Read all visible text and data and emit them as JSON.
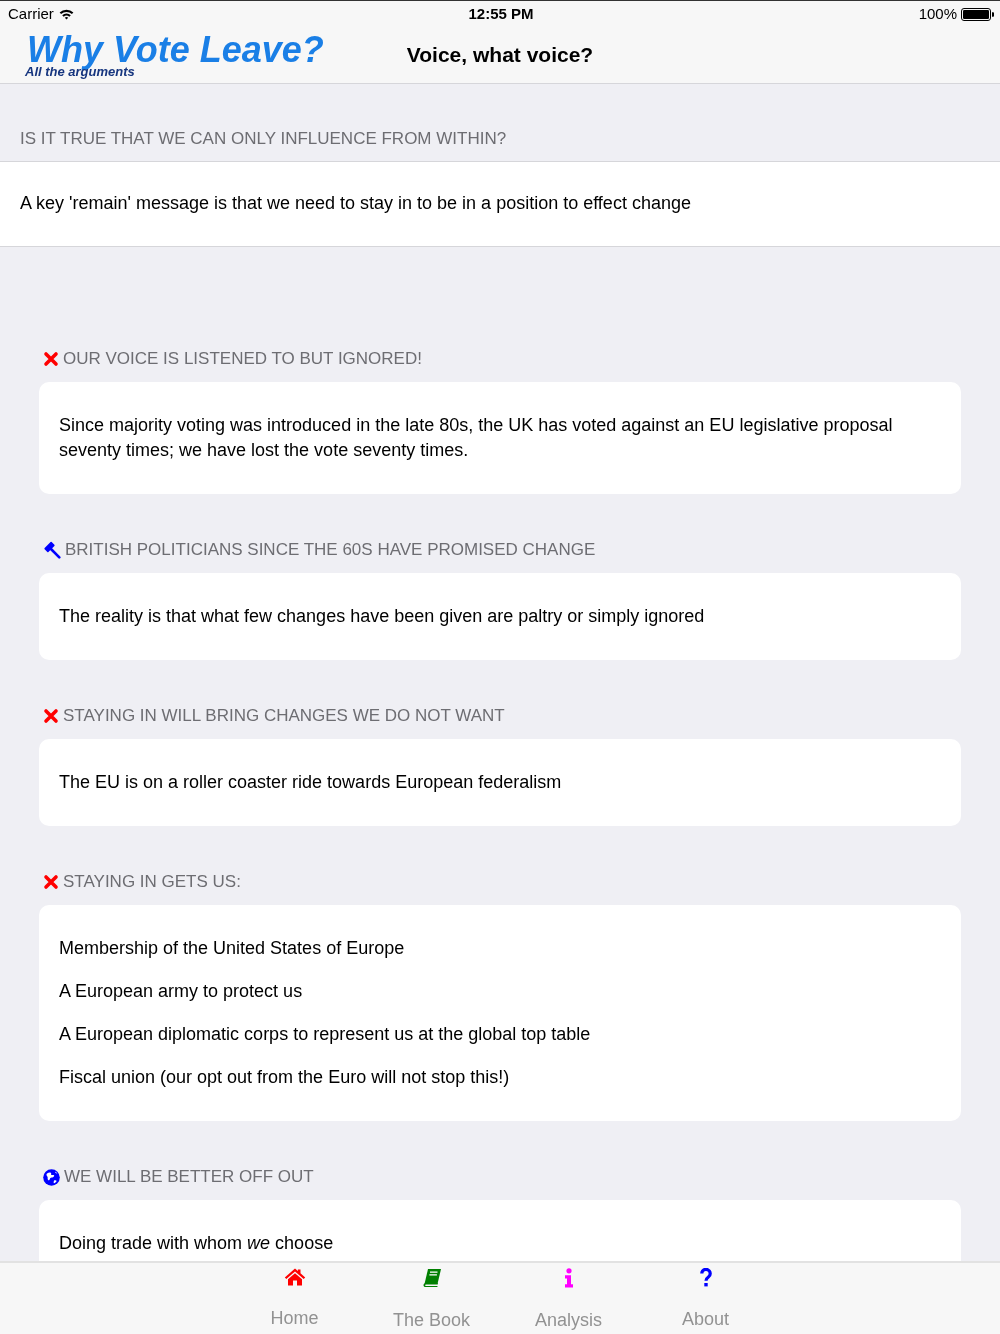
{
  "status_bar": {
    "carrier": "Carrier",
    "time": "12:55 PM",
    "battery": "100%"
  },
  "nav_bar": {
    "logo_title": "Why Vote Leave?",
    "logo_subtitle": "All the arguments",
    "title": "Voice, what voice?"
  },
  "intro": {
    "heading": "IS IT TRUE THAT WE CAN ONLY INFLUENCE FROM WITHIN?",
    "text": "A key 'remain' message is that we need to stay in to be in a position to effect change"
  },
  "sections": [
    {
      "kind": "cross",
      "heading": "OUR VOICE IS LISTENED TO BUT IGNORED!",
      "lines": [
        "Since majority voting was introduced in the late 80s, the UK has voted against an EU legislative proposal seventy times; we have lost the vote seventy times."
      ]
    },
    {
      "kind": "gavel",
      "heading": "BRITISH POLITICIANS SINCE THE 60S HAVE PROMISED CHANGE",
      "lines": [
        "The reality is that what few changes have been given are paltry or simply ignored"
      ]
    },
    {
      "kind": "cross",
      "heading": "STAYING IN WILL BRING CHANGES WE DO NOT WANT",
      "lines": [
        "The EU is on a roller coaster ride towards European federalism"
      ]
    },
    {
      "kind": "cross",
      "heading": "STAYING IN GETS US:",
      "lines": [
        "Membership of the United States of Europe",
        "A European army to protect us",
        "A European diplomatic corps to represent us at the global top table",
        "Fiscal union (our opt out from the Euro will not stop this!)"
      ]
    },
    {
      "kind": "globe",
      "heading": "WE WILL BE BETTER OFF OUT",
      "lines": [
        "Doing trade with whom *we* choose"
      ]
    }
  ],
  "tab_bar": [
    {
      "kind": "home",
      "label": "Home",
      "color": "#ff0000",
      "selected": false
    },
    {
      "kind": "book",
      "label": "The Book",
      "color": "#008000",
      "selected": false
    },
    {
      "kind": "info",
      "label": "Analysis",
      "color": "#ff00ff",
      "selected": false
    },
    {
      "kind": "help",
      "label": "About",
      "color": "#0000ff",
      "selected": false
    }
  ]
}
